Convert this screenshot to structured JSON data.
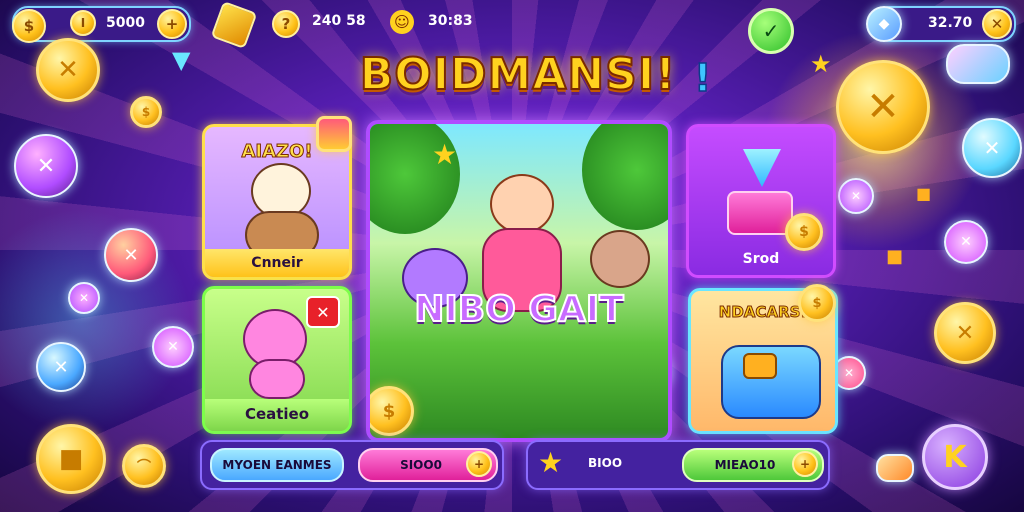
{
  "hud": {
    "coins_value": "5000",
    "stat_1_value": "240 58",
    "stat_2_value": "30:83",
    "right_value": "32.70"
  },
  "title": {
    "text": "BOIDMANSI!",
    "accent": "!"
  },
  "cards": {
    "top_left_title": "AIAZO!",
    "top_left_label": "Cnneir",
    "bottom_left_label": "Ceatieo",
    "center_title": "NIBO GAIT",
    "top_right_label": "Srod",
    "bottom_right_title": "NDACARS!"
  },
  "bottom_left_bar": {
    "left_label": "MYOEN EANMES",
    "right_label": "SIOO0"
  },
  "bottom_right_bar": {
    "left_label": "BIOO",
    "right_label": "MIEAO10"
  },
  "icons": [
    "coin-icon",
    "plus-icon",
    "gem-icon",
    "star-icon",
    "check-icon",
    "close-icon",
    "back-icon",
    "gamepad-icon"
  ],
  "colors": {
    "accent": "#b04cff",
    "gold": "#ffc21a",
    "cyan": "#7fd3ff",
    "pink": "#ff3fd0",
    "green": "#7dff4a"
  }
}
